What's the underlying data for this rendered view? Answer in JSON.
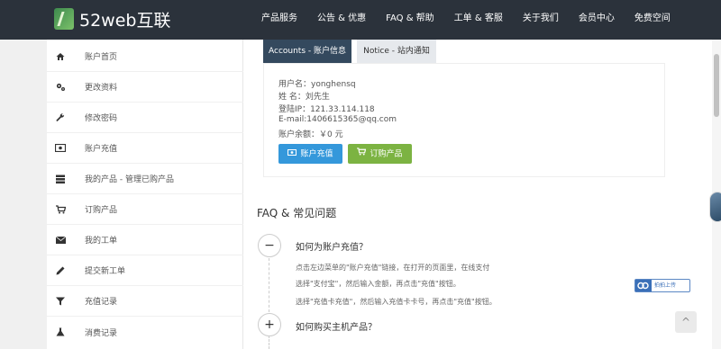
{
  "header": {
    "brand": "52web互联",
    "nav": [
      "产品服务",
      "公告 & 优惠",
      "FAQ & 帮助",
      "工单 & 客服",
      "关于我们",
      "会员中心",
      "免费空间"
    ]
  },
  "sidebar": {
    "items": [
      {
        "label": "账户首页",
        "icon": "home-icon"
      },
      {
        "label": "更改资料",
        "icon": "gears-icon"
      },
      {
        "label": "修改密码",
        "icon": "wrench-icon"
      },
      {
        "label": "账户充值",
        "icon": "money-icon"
      },
      {
        "label": "我的产品 - 管理已购产品",
        "icon": "server-icon"
      },
      {
        "label": "订购产品",
        "icon": "cart-icon"
      },
      {
        "label": "我的工单",
        "icon": "envelope-icon"
      },
      {
        "label": "提交新工单",
        "icon": "pencil-icon"
      },
      {
        "label": "充值记录",
        "icon": "filter-icon"
      },
      {
        "label": "消费记录",
        "icon": "flask-icon"
      }
    ]
  },
  "tabs": {
    "accounts": "Accounts - 账户信息",
    "notice": "Notice - 站内通知"
  },
  "account": {
    "username": "用户名：yonghensq",
    "name": "姓  名：刘先生",
    "ip": "登陆IP：121.33.114.118",
    "email": "E-mail:1406615365@qq.com",
    "balance": "账户余额：￥0 元"
  },
  "buttons": {
    "recharge": "账户充值",
    "order": "订购产品"
  },
  "faq": {
    "title": "FAQ & 常见问题",
    "q1": "如何为账户充值？",
    "a1_line1": "点击左边菜单的\"账户充值\"链接，在打开的页面里，在线支付",
    "a1_line2": "选择\"支付宝\"，然后输入金额，再点击\"充值\"按钮。",
    "a1_line3": "选择\"充值卡充值\"，然后输入充值卡卡号，再点击\"充值\"按钮。",
    "q2": "如何购买主机产品？",
    "open_symbol": "−",
    "closed_symbol": "+"
  },
  "widgets": {
    "share_label": "拍拍上传",
    "top_symbol": "^"
  },
  "colors": {
    "header_bg": "#2b323b",
    "tab_active": "#34495e",
    "btn_blue": "#3498db",
    "btn_green": "#7cb342"
  }
}
